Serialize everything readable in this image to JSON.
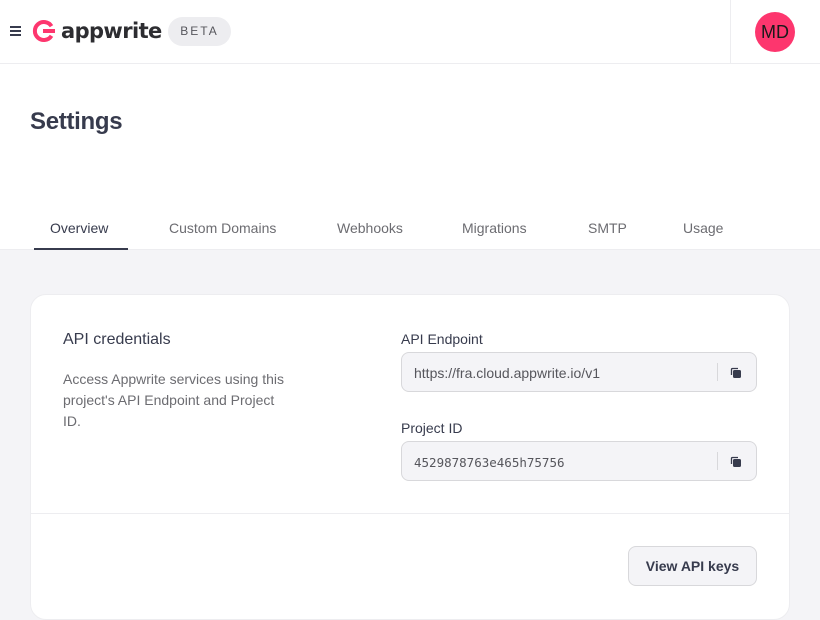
{
  "header": {
    "brand": "appwrite",
    "badge": "BETA",
    "avatar_initials": "MD",
    "accent_color": "#fd366e"
  },
  "page": {
    "title": "Settings"
  },
  "tabs": [
    {
      "label": "Overview",
      "active": true
    },
    {
      "label": "Custom Domains",
      "active": false
    },
    {
      "label": "Webhooks",
      "active": false
    },
    {
      "label": "Migrations",
      "active": false
    },
    {
      "label": "SMTP",
      "active": false
    },
    {
      "label": "Usage",
      "active": false
    }
  ],
  "credentials": {
    "title": "API credentials",
    "description": "Access Appwrite services using this project's API Endpoint and Project ID.",
    "endpoint_label": "API Endpoint",
    "endpoint_value": "https://fra.cloud.appwrite.io/v1",
    "project_id_label": "Project ID",
    "project_id_value": "4529878763e465h75756",
    "view_keys_label": "View API keys"
  },
  "icons": {
    "menu": "hamburger-menu-icon",
    "logo": "appwrite-logo-icon",
    "copy": "copy-icon"
  }
}
